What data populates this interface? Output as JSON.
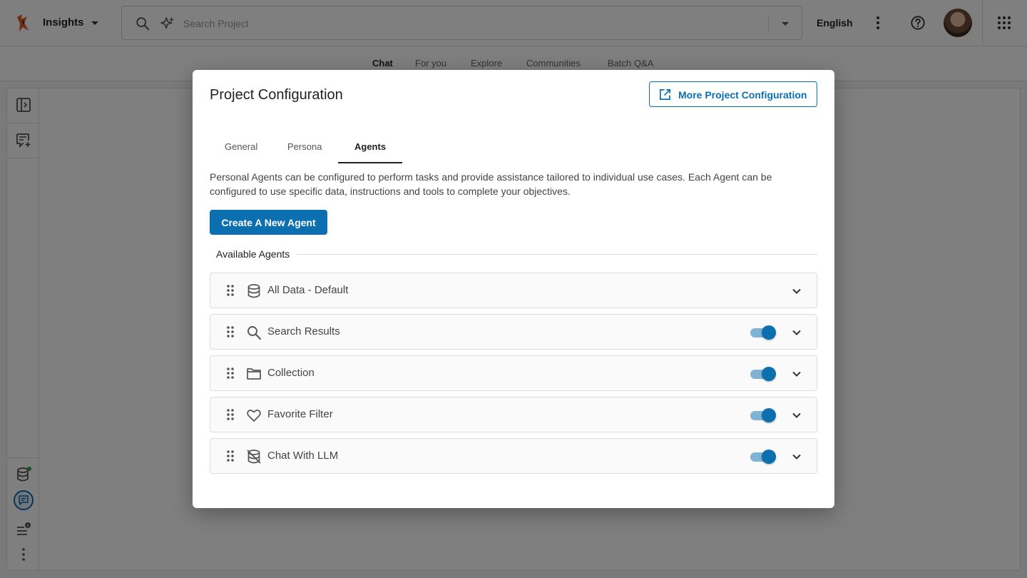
{
  "header": {
    "app_name": "Insights",
    "search_placeholder": "Search Project",
    "language": "English",
    "icons": [
      "logo-icon",
      "search-icon",
      "sparkle-icon",
      "more-vert-icon",
      "help-icon",
      "apps-grid-icon"
    ]
  },
  "nav": {
    "tabs": [
      {
        "label": "Chat",
        "active": true
      },
      {
        "label": "For you",
        "active": false
      },
      {
        "label": "Explore",
        "active": false
      },
      {
        "label": "Communities",
        "active": false
      },
      {
        "label": "Batch Q&A",
        "active": false
      }
    ]
  },
  "sidebar": {
    "icons": [
      "sidebar-toggle-icon",
      "new-chat-icon",
      "database-icon",
      "chat-icon",
      "list-info-icon",
      "more-vert-icon"
    ]
  },
  "modal": {
    "title": "Project Configuration",
    "more_config_label": "More Project Configuration",
    "tabs": [
      {
        "label": "General",
        "active": false
      },
      {
        "label": "Persona",
        "active": false
      },
      {
        "label": "Agents",
        "active": true
      }
    ],
    "description": "Personal Agents can be configured to perform tasks and provide assistance tailored to individual use cases. Each Agent can be configured to use specific data, instructions and tools to complete your objectives.",
    "create_label": "Create A New Agent",
    "section_label": "Available Agents",
    "agents": [
      {
        "name": "All Data - Default",
        "icon": "database-icon",
        "enabled": null
      },
      {
        "name": "Search Results",
        "icon": "search-icon",
        "enabled": true
      },
      {
        "name": "Collection",
        "icon": "folder-icon",
        "enabled": true
      },
      {
        "name": "Favorite Filter",
        "icon": "heart-icon",
        "enabled": true
      },
      {
        "name": "Chat With LLM",
        "icon": "llm-off-icon",
        "enabled": true
      }
    ]
  },
  "colors": {
    "primary": "#0b6fb0",
    "toggle_track": "#7fb3d6",
    "status_dot": "#2e9e3e"
  }
}
